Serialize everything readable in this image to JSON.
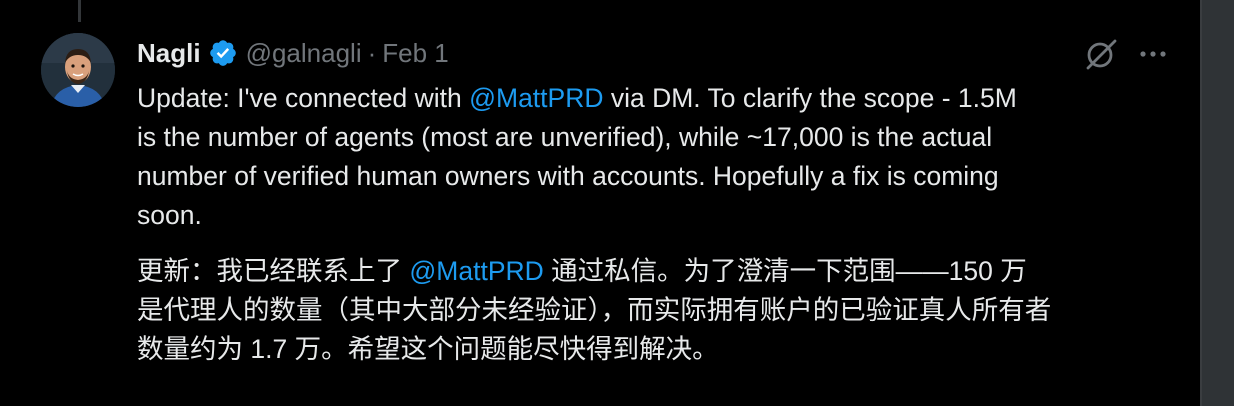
{
  "author": {
    "display_name": "Nagli",
    "handle": "@galnagli",
    "separator": "·",
    "date": "Feb 1"
  },
  "icons": {
    "verified": "verified-badge-icon",
    "grok": "grok-icon",
    "more": "more-options-icon"
  },
  "colors": {
    "background": "#000000",
    "text": "#e7e9ea",
    "secondary": "#71767b",
    "accent": "#1d9bf0"
  },
  "tweet": {
    "english": {
      "line1_before": "Update: I've connected with ",
      "mention": "@MattPRD",
      "line1_after": " via DM. To clarify the scope - 1.5M",
      "line2": "is the number of agents (most are unverified), while ~17,000 is the actual",
      "line3": "number of verified human owners with accounts. Hopefully a fix is coming",
      "line4": "soon."
    },
    "chinese": {
      "line1_before": "更新：我已经联系上了 ",
      "mention": "@MattPRD",
      "line1_after": " 通过私信。为了澄清一下范围——150 万",
      "line2": "是代理人的数量（其中大部分未经验证），而实际拥有账户的已验证真人所有者",
      "line3": "数量约为 1.7 万。希望这个问题能尽快得到解决。"
    }
  }
}
